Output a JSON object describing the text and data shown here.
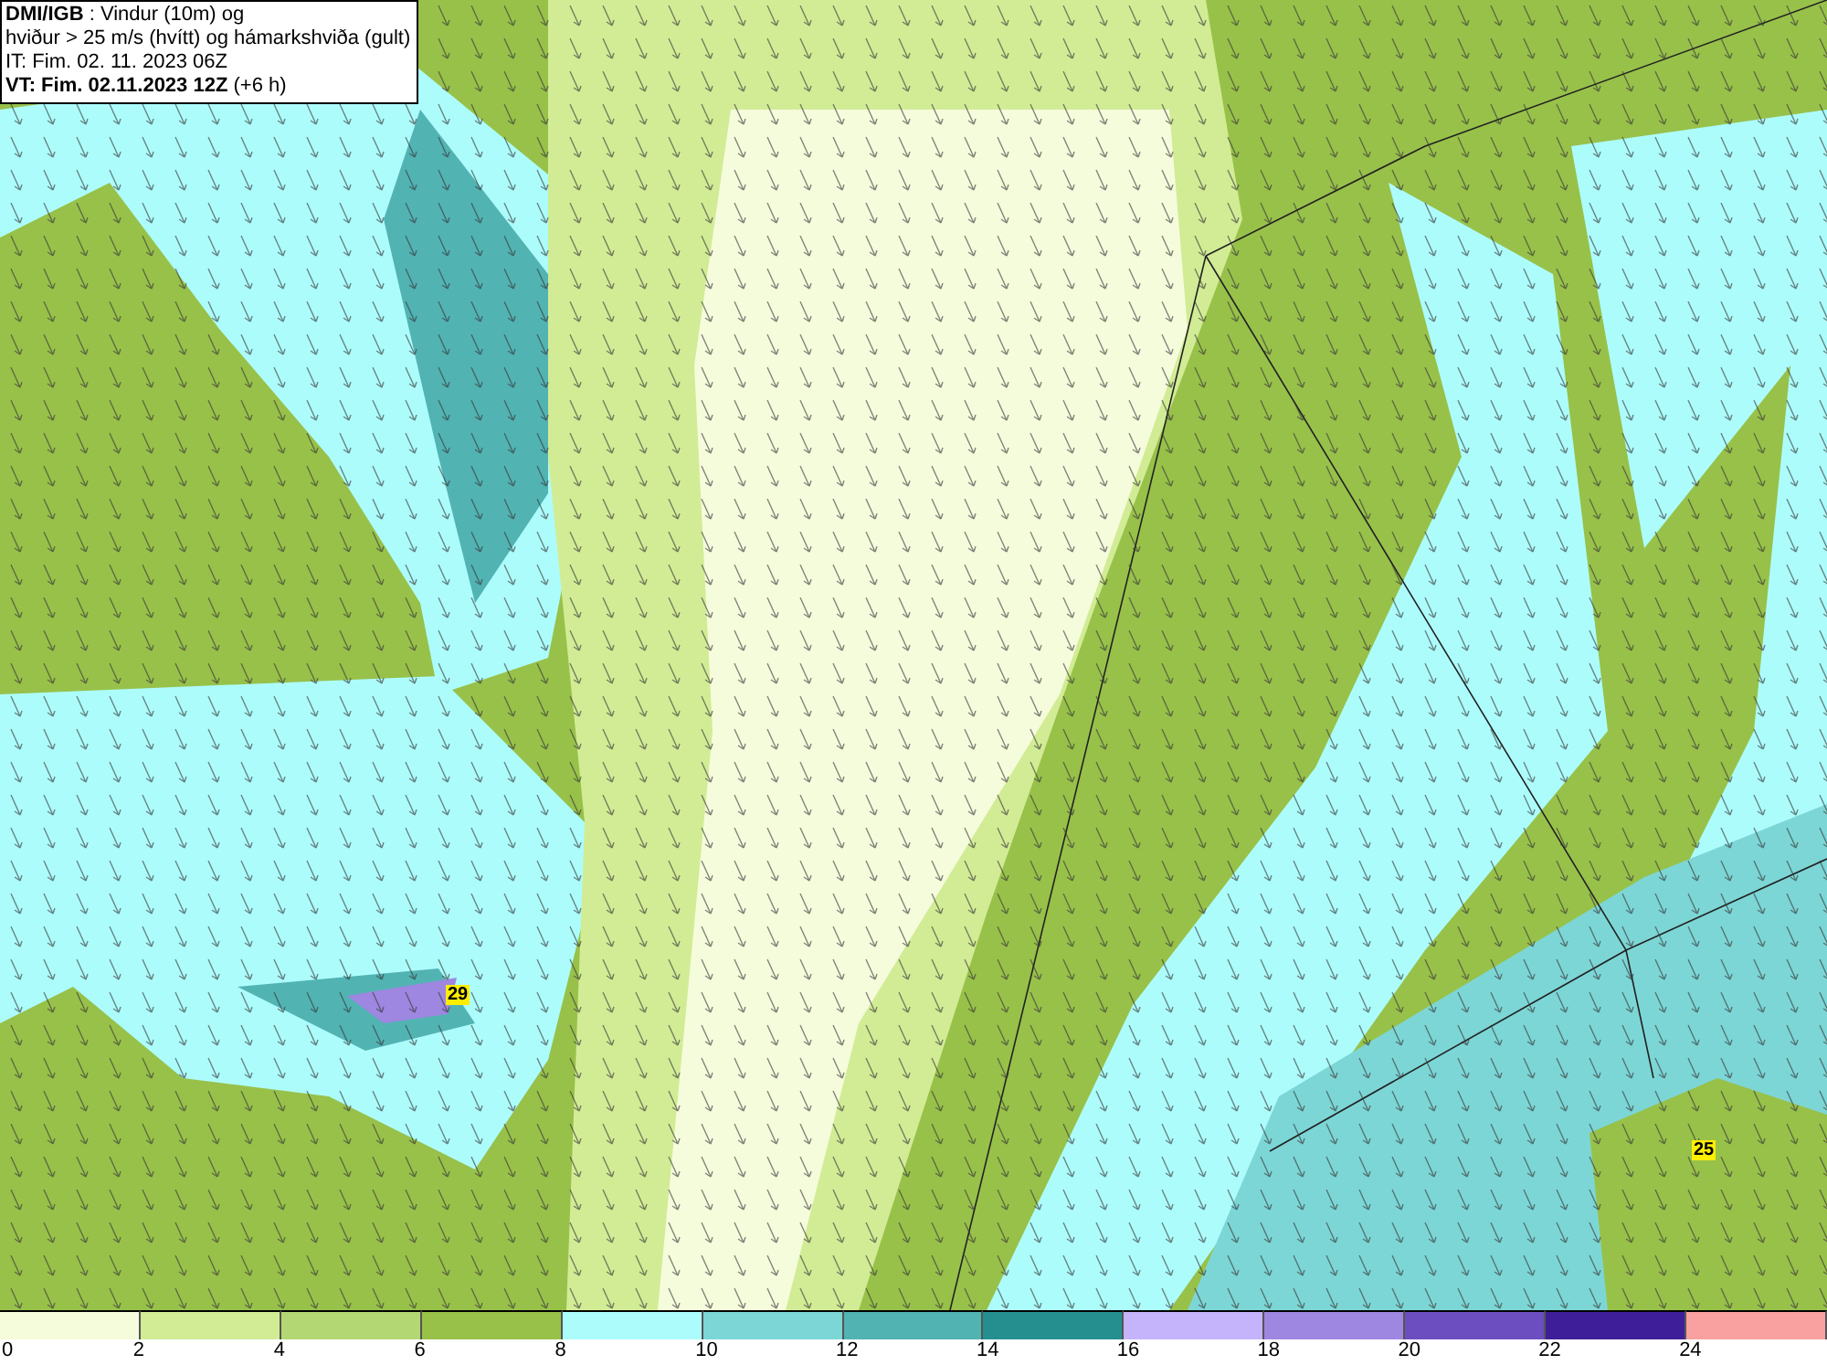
{
  "title_box": {
    "lines": [
      "**DMI/IGB** : Vindur (10m) og",
      "hviður > 25 m/s (hvítt) og hámarkshviða (gult)",
      "IT: Fim. 02. 11. 2023 06Z",
      "**VT: Fim. 02.11.2023 12Z** (+6 h)"
    ]
  },
  "map": {
    "gust_markers": [
      {
        "value": "29"
      },
      {
        "value": "25"
      }
    ]
  },
  "legend": {
    "bins": [
      {
        "label": "0",
        "color": "#f5fcdc"
      },
      {
        "label": "2",
        "color": "#d2ec96"
      },
      {
        "label": "4",
        "color": "#b3d873"
      },
      {
        "label": "6",
        "color": "#98c14a"
      },
      {
        "label": "8",
        "color": "#adfcfc"
      },
      {
        "label": "10",
        "color": "#7dd6d6"
      },
      {
        "label": "12",
        "color": "#52b3b3"
      },
      {
        "label": "14",
        "color": "#258f8f"
      },
      {
        "label": "16",
        "color": "#c5b3fc"
      },
      {
        "label": "18",
        "color": "#9e87e0"
      },
      {
        "label": "20",
        "color": "#6c4ec1"
      },
      {
        "label": "22",
        "color": "#3e1f99"
      },
      {
        "label": "24",
        "color": "#f9a0a0"
      }
    ]
  }
}
